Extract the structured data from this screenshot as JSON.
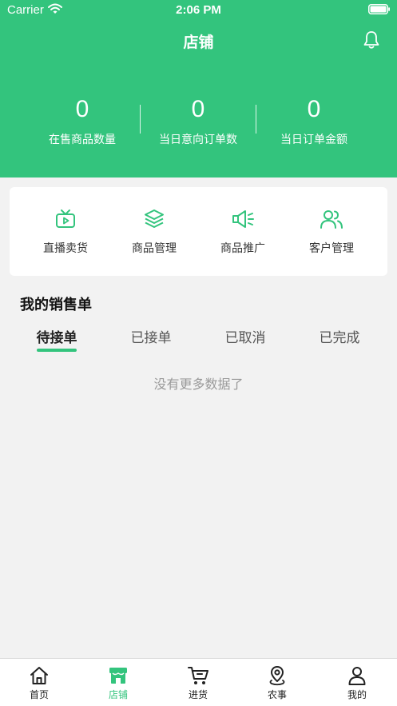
{
  "status_bar": {
    "carrier": "Carrier",
    "time": "2:06 PM"
  },
  "header": {
    "title": "店铺"
  },
  "stats": [
    {
      "value": "0",
      "label": "在售商品数量"
    },
    {
      "value": "0",
      "label": "当日意向订单数"
    },
    {
      "value": "0",
      "label": "当日订单金额"
    }
  ],
  "menu": [
    {
      "label": "直播卖货",
      "icon": "tv-play-icon"
    },
    {
      "label": "商品管理",
      "icon": "layers-icon"
    },
    {
      "label": "商品推广",
      "icon": "megaphone-icon"
    },
    {
      "label": "客户管理",
      "icon": "users-icon"
    }
  ],
  "orders": {
    "title": "我的销售单",
    "tabs": [
      "待接单",
      "已接单",
      "已取消",
      "已完成"
    ],
    "active_tab": "待接单",
    "empty_text": "没有更多数据了"
  },
  "tabbar": [
    {
      "label": "首页",
      "icon": "home-icon"
    },
    {
      "label": "店铺",
      "icon": "store-icon",
      "active": true
    },
    {
      "label": "进货",
      "icon": "cart-icon"
    },
    {
      "label": "农事",
      "icon": "location-pin-icon"
    },
    {
      "label": "我的",
      "icon": "user-icon"
    }
  ],
  "colors": {
    "accent": "#33c47d",
    "background": "#f2f2f2"
  }
}
